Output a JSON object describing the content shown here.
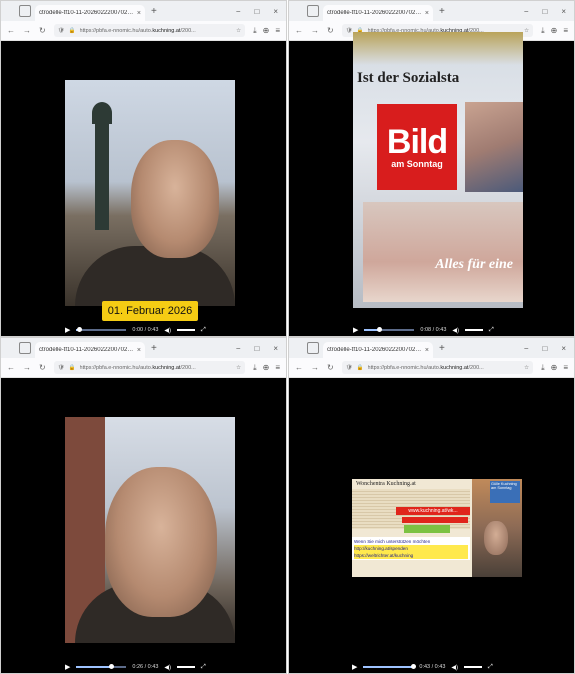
{
  "windows": [
    {
      "tab_title": "ctrodelle-tf10-11-2026022200702.mp4",
      "url_prefix": "https://pbfa.e-nnomic.hu/auto.",
      "url_domain": "kuchning.at",
      "url_suffix": "/200...",
      "date_overlay": "01. Februar 2026",
      "time": "0:00 / 0:43",
      "progress": 0.05
    },
    {
      "tab_title": "ctrodelle-tf10-11-2026022200702.mp4",
      "url_prefix": "https://pbfa.e-nnomic.hu/auto.",
      "url_domain": "kuchning.at",
      "url_suffix": "/200...",
      "headline": "Ist der Sozialsta",
      "bild_word": "Bild",
      "bild_sub": "am Sonntag",
      "tagline": "Alles für eine",
      "time": "0:08 / 0:43",
      "progress": 0.3
    },
    {
      "tab_title": "ctrodelle-tf10-11-2026022200702.mp4",
      "url_prefix": "https://pbfa.e-nnomic.hu/auto.",
      "url_domain": "kuchning.at",
      "url_suffix": "/200...",
      "time": "0:26 / 0:43",
      "progress": 0.7
    },
    {
      "tab_title": "ctrodelle-tf10-11-2026022200702.mp4",
      "url_prefix": "https://pbfa.e-nnomic.hu/auto.",
      "url_domain": "kuchning.at",
      "url_suffix": "/200...",
      "collage_head": "Wonchentra Kuchning.at",
      "collage_banner": "www.kuchning.at/wk...",
      "caption_line1": "Wenn Sie mich unterstützen möchten",
      "caption_line2": "http://kuchning.at/spenden",
      "caption_line3": "https://weltrichter.at/kuchning",
      "blue_note": "Gülle Kuchning am Sonntag",
      "time": "0:43 / 0:43",
      "progress": 0.99
    }
  ],
  "icons": {
    "close": "×",
    "new_tab": "+",
    "minimize": "−",
    "maximize": "□",
    "back": "←",
    "forward": "→",
    "reload": "↻",
    "play": "▶",
    "volume": "◀)",
    "fullscreen": "⤢"
  }
}
